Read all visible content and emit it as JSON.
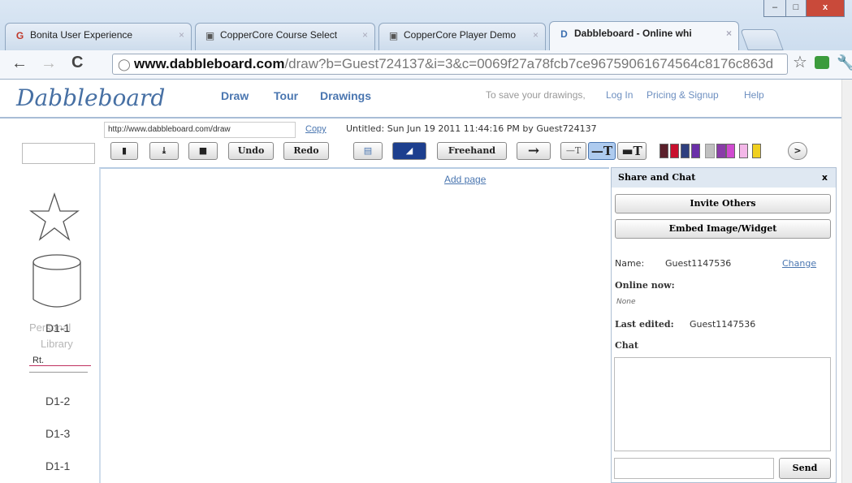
{
  "browser": {
    "tabs": [
      {
        "label": "Bonita User Experience",
        "favicon": "bonita-icon"
      },
      {
        "label": "CopperCore Course Select",
        "favicon": "coppercore-icon"
      },
      {
        "label": "CopperCore Player Demo",
        "favicon": "coppercore-icon"
      },
      {
        "label": "Dabbleboard - Online whi",
        "favicon": "dabbleboard-icon"
      }
    ],
    "address_host": "www.dabbleboard.com",
    "address_path": "/draw?b=Guest724137&i=3&c=0069f27a78fcb7ce96759061674564c8176c863d"
  },
  "site": {
    "logo": "Dabbleboard",
    "nav": [
      "Draw",
      "Tour",
      "Drawings"
    ],
    "save_prompt": "To save your drawings,",
    "login": "Log In",
    "pricing": "Pricing & Signup",
    "help": "Help"
  },
  "board": {
    "share_url": "http://www.dabbleboard.com/draw",
    "copy_label": "Copy",
    "title_line": "Untitled: Sun Jun 19 2011 11:44:16 PM by Guest724137",
    "add_page": "Add page"
  },
  "toolbar": {
    "undo": "Undo",
    "redo": "Redo",
    "freehand": "Freehand",
    "arrow": "→",
    "line_small": "—T",
    "line_medium": "—T",
    "line_large": "▬T",
    "more": ">",
    "colors": [
      "#5b1f2a",
      "#c8102e",
      "#2f3f7f",
      "#6a2fa8",
      "#d04bd0",
      "#f3b7e8",
      "#f0d020"
    ]
  },
  "library": {
    "labels": [
      "D1-1",
      "D1-2",
      "D1-3",
      "D1-1"
    ],
    "faded_labels": [
      "Personal",
      "Library"
    ],
    "text_prefix": "P",
    "text_suffix": "al"
  },
  "share": {
    "title": "Share and Chat",
    "close": "x",
    "invite": "Invite Others",
    "embed": "Embed Image/Widget",
    "name_label": "Name:",
    "name_value": "Guest1147536",
    "change": "Change",
    "online_label": "Online now:",
    "online_value": "None",
    "last_edited_label": "Last edited:",
    "last_edited_value": "Guest1147536",
    "chat_label": "Chat",
    "send": "Send"
  }
}
